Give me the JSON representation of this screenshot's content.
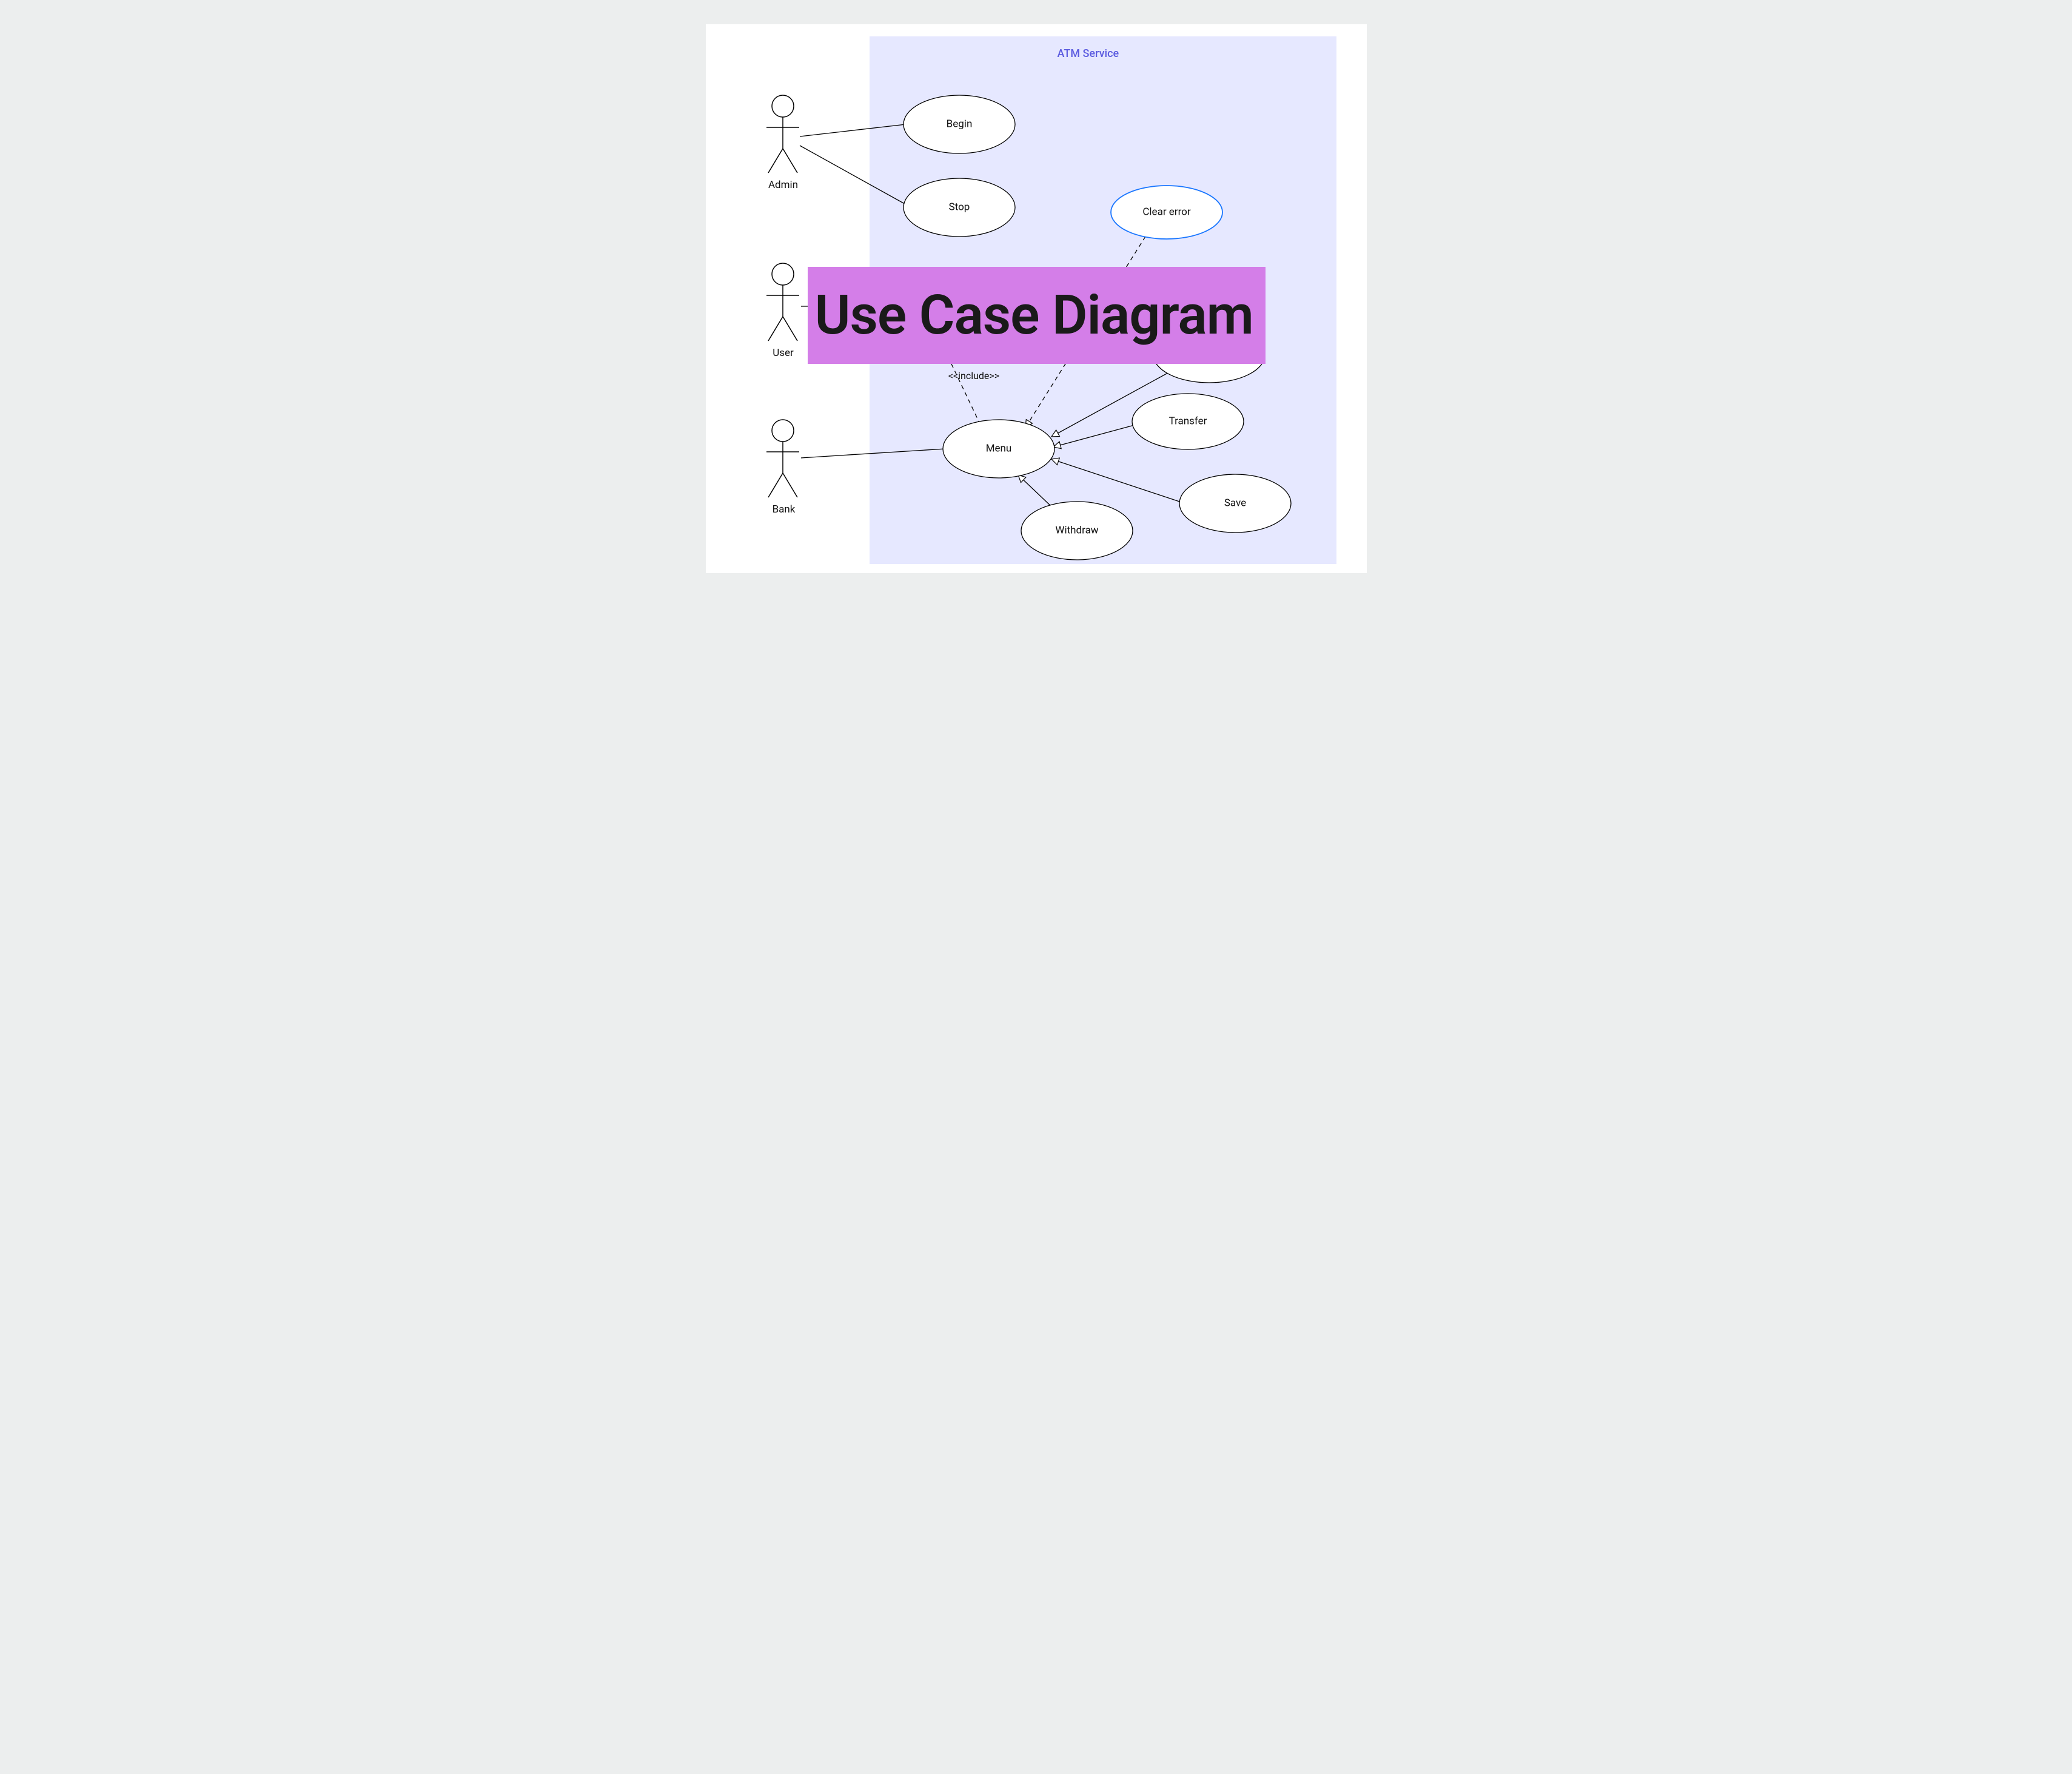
{
  "system": {
    "title": "ATM Service"
  },
  "actors": [
    {
      "key": "admin",
      "label": "Admin"
    },
    {
      "key": "user",
      "label": "User"
    },
    {
      "key": "bank",
      "label": "Bank"
    }
  ],
  "usecases": {
    "begin": {
      "label": "Begin"
    },
    "stop": {
      "label": "Stop"
    },
    "clearError": {
      "label": "Clear error"
    },
    "menu": {
      "label": "Menu"
    },
    "transfer": {
      "label": "Transfer"
    },
    "save": {
      "label": "Save"
    },
    "withdraw": {
      "label": "Withdraw"
    }
  },
  "edges": {
    "include_label": "<<include>>"
  },
  "overlay": {
    "text": "Use Case Diagram"
  },
  "colors": {
    "systemFill": "#e6e8ff",
    "systemTitle": "#5c5ce0",
    "selectedStroke": "#1976ff",
    "bannerFill": "#d47ee8"
  }
}
